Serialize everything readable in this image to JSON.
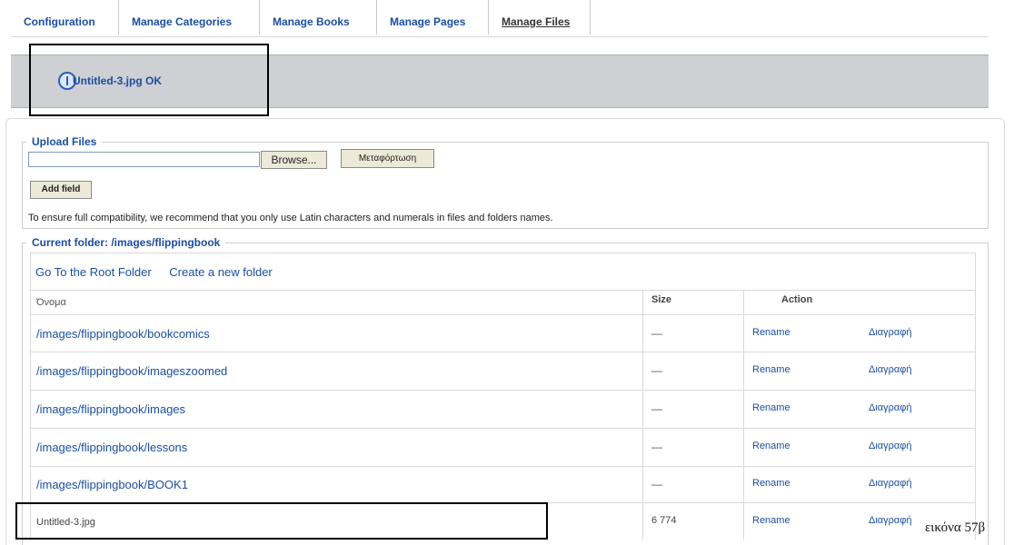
{
  "tabs": [
    {
      "label": "Configuration"
    },
    {
      "label": "Manage Categories"
    },
    {
      "label": "Manage Books"
    },
    {
      "label": "Manage Pages"
    },
    {
      "label": "Manage Files"
    }
  ],
  "message": {
    "text": "Untitled-3.jpg OK",
    "icon": "info-icon"
  },
  "upload": {
    "legend": "Upload Files",
    "browse_label": "Browse...",
    "upload_label": "Μεταφόρτωση",
    "add_field_label": "Add field",
    "note": "To ensure full compatibility, we recommend that you only use Latin characters and numerals in files and folders names."
  },
  "folder": {
    "legend": "Current folder: /images/flippingbook",
    "root_link": "Go To the Root Folder",
    "create_link": "Create a new folder",
    "columns": {
      "name": "Όνομα",
      "size": "Size",
      "action": "Action"
    },
    "rows": [
      {
        "name": "/images/flippingbook/bookcomics",
        "size": "—",
        "rename": "Rename",
        "delete": "Διαγραφή"
      },
      {
        "name": "/images/flippingbook/imageszoomed",
        "size": "—",
        "rename": "Rename",
        "delete": "Διαγραφή"
      },
      {
        "name": "/images/flippingbook/images",
        "size": "—",
        "rename": "Rename",
        "delete": "Διαγραφή"
      },
      {
        "name": "/images/flippingbook/lessons",
        "size": "—",
        "rename": "Rename",
        "delete": "Διαγραφή"
      },
      {
        "name": "/images/flippingbook/BOOK1",
        "size": "—",
        "rename": "Rename",
        "delete": "Διαγραφή"
      }
    ],
    "file_row": {
      "name": "Untitled-3.jpg",
      "size": "6 774",
      "rename": "Rename",
      "delete": "Διαγραφή"
    }
  },
  "caption": "εικόνα 57β",
  "colors": {
    "link": "#1b4ea0",
    "message_bg": "#cfd0d3"
  }
}
